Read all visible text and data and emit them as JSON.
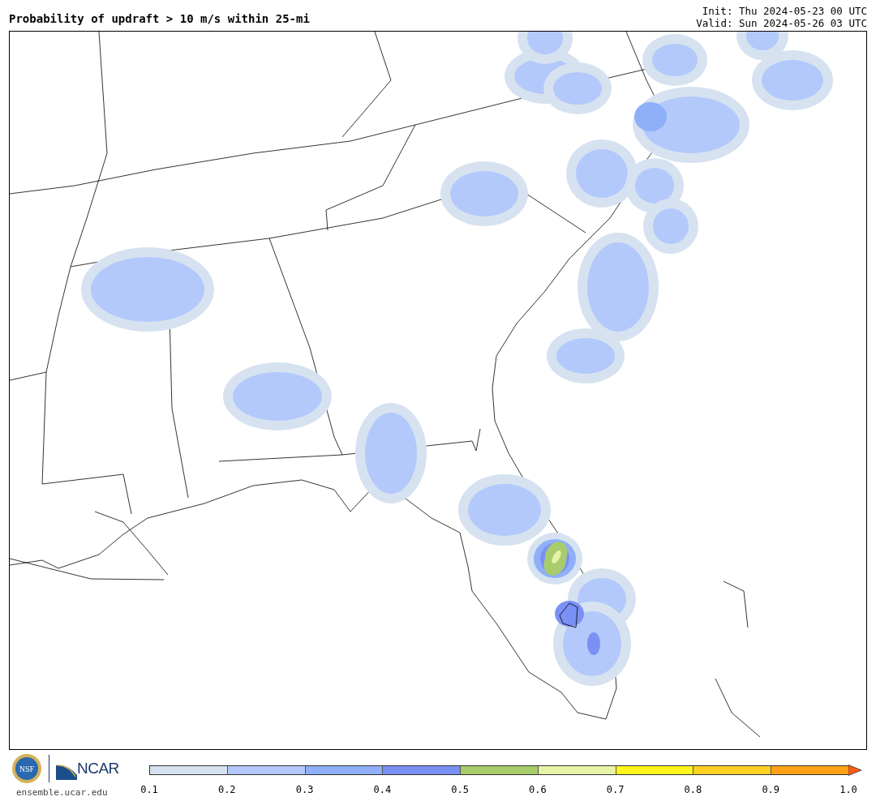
{
  "title": "Probability of updraft > 10 m/s within 25-mi",
  "init": "Init: Thu 2024-05-23 00 UTC",
  "valid": "Valid: Sun 2024-05-26 03 UTC",
  "logos": {
    "nsf": "NSF",
    "ncar": "NCAR"
  },
  "website": "ensemble.ucar.edu",
  "colorbar": {
    "segments": [
      {
        "color": "#d6e2f0"
      },
      {
        "color": "#b3c8fb"
      },
      {
        "color": "#8fb0f8"
      },
      {
        "color": "#7b90f4"
      },
      {
        "color": "#a8cc6b"
      },
      {
        "color": "#e6f4a6"
      },
      {
        "color": "#fff51a"
      },
      {
        "color": "#ffd024"
      },
      {
        "color": "#ffa114"
      }
    ],
    "extend_arrow": {
      "color": "#ff5a14"
    },
    "ticks": [
      "0.1",
      "0.2",
      "0.3",
      "0.4",
      "0.5",
      "0.6",
      "0.7",
      "0.8",
      "0.9",
      "1.0"
    ]
  }
}
